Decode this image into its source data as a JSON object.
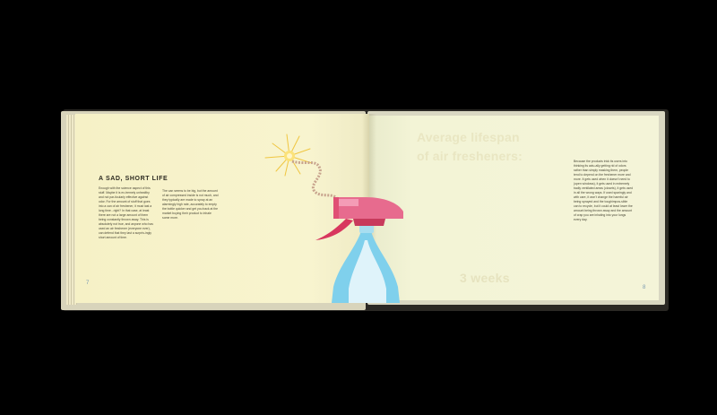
{
  "left_page": {
    "heading": "A SAD, SHORT LIFE",
    "column1": "Enough with the science aspect of this stuff. Maybe it is ex-tremely unhealthy and not par-ticularly effective against odor. For the amount of stuff that goes into a can of air freshener, it must last a long time...right? In that case, at least there are not a large amount of them being constantly thrown away. This is absolutely not true, and anyone who has used an air freshener (everyone ever), can defend that they last a surpris-ingly short amount of time.",
    "column2": "The can seems to be big, but the amount of air compressed inside is not much, and they typically are made to spray at an alarmingly high rate, accurately to empty the bottle quicker and get you back at the market buying their product to inhale some more.",
    "page_number": "7"
  },
  "right_page": {
    "title_line1": "Average lifespan",
    "title_line2": "of air fresheners:",
    "value": "3 weeks",
    "column": "Because the products trick its users into thinking its actu-ally getting rid of odors rather than simply masking them, people tend to depend on the freshener more and more. It gets used when it doesn't need to (open windows), it gets used in extremely badly ventilated areas (closets), it gets used in all the wrong ways. If used sparingly and with care, it won't change the harmful air being sprayed and the toughimpos-sible can to recycle, but it could at least lower the amount being thrown away and the amount of crap you are inhaling into your lungs every day.",
    "page_number": "8"
  },
  "illustration": {
    "subject": "spray-bottle-with-lit-fuse",
    "colors": {
      "trigger": "#e0506e",
      "nozzle": "#e76b8e",
      "bottle": "#7fd0ec",
      "fuse": "#c8a48e",
      "spark": "#f5d02a"
    }
  }
}
